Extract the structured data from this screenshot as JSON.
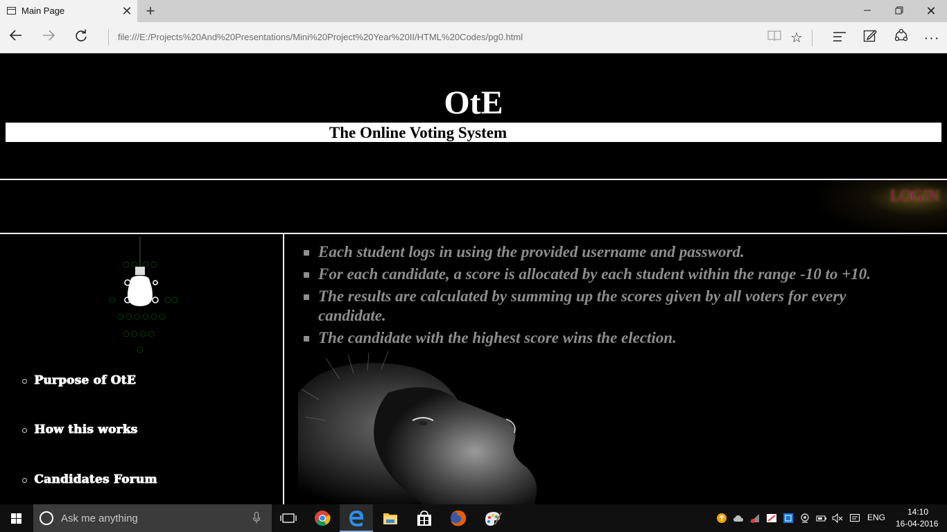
{
  "browser": {
    "tab_title": "Main Page",
    "address": "file:///E:/Projects%20And%20Presentations/Mini%20Project%20Year%20II/HTML%20Codes/pg0.html",
    "icons": [
      "page-icon",
      "close-icon",
      "plus-icon",
      "minimize-icon",
      "restore-icon",
      "close-window-icon",
      "back-icon",
      "forward-icon",
      "refresh-icon",
      "reading-view-icon",
      "favorite-star-icon",
      "hub-icon",
      "web-note-icon",
      "share-icon",
      "more-icon"
    ]
  },
  "site": {
    "title": "OtE",
    "subtitle": "The Online Voting System",
    "login_label": "LOGIN",
    "login_color": "#8a1a52"
  },
  "menu": {
    "items": [
      {
        "label": "Purpose of OtE"
      },
      {
        "label": "How this works"
      },
      {
        "label": "Candidates Forum"
      }
    ]
  },
  "rules": {
    "items": [
      {
        "text": "Each student logs in using the provided username and password."
      },
      {
        "text": "For each candidate, a score is allocated by each student within the range -10 to +10."
      },
      {
        "text": "The results are calculated by summing up the scores given by all voters for every candidate."
      },
      {
        "text": "The candidate with the highest score wins the election."
      }
    ],
    "text_color": "#8e8e8e"
  },
  "taskbar": {
    "search_placeholder": "Ask me anything",
    "language": "ENG",
    "time": "14:10",
    "date": "16-04-2016",
    "apps": [
      "task-view-icon",
      "chrome-icon",
      "edge-icon",
      "file-explorer-icon",
      "store-icon",
      "firefox-icon",
      "paint-icon"
    ]
  }
}
